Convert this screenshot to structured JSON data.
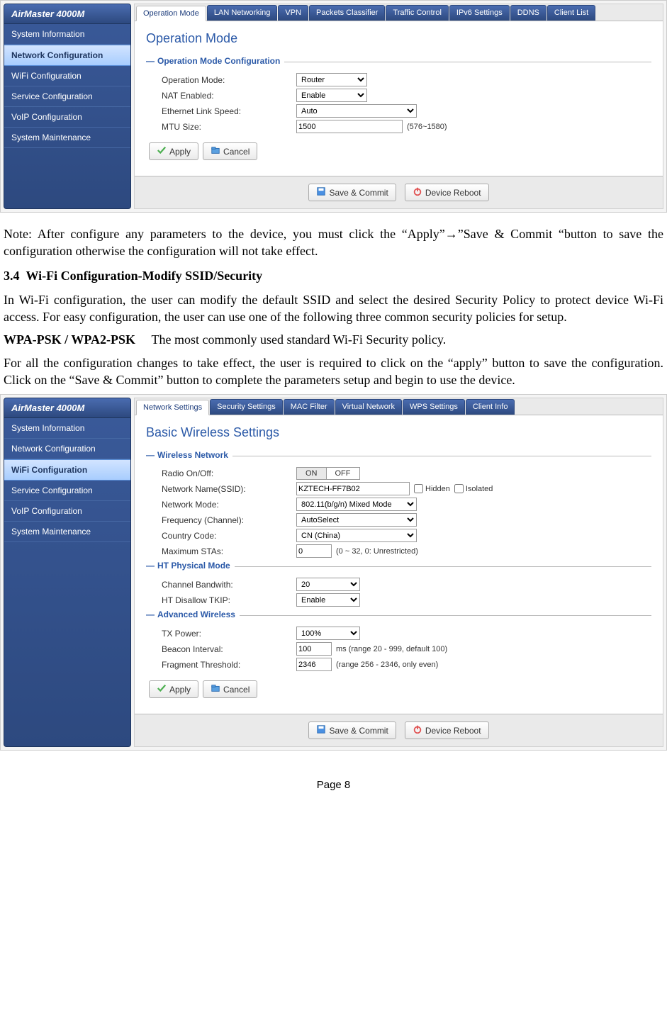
{
  "doc": {
    "note": "Note: After configure any parameters to the device, you must click the “Apply”→”Save & Commit “button to save the configuration otherwise the configuration will not take effect.",
    "section_number": "3.4",
    "section_title": "Wi-Fi Configuration-Modify SSID/Security",
    "para1": "In Wi-Fi configuration, the user can modify the default SSID and select the desired Security Policy to protect device Wi-Fi access. For easy configuration, the user can use one of the following three common security policies for setup.",
    "wpa_label": "WPA-PSK / WPA2-PSK",
    "wpa_desc": "The most commonly used standard Wi-Fi Security policy.",
    "para2": "For all the configuration changes to take effect, the user is required to click on the “apply” button to save the configuration. Click on the “Save & Commit” button to complete the parameters setup and begin to use the device.",
    "page_label": "Page 8"
  },
  "ui1": {
    "product": "AirMaster 4000M",
    "sidebar": [
      "System Information",
      "Network Configuration",
      "WiFi Configuration",
      "Service Configuration",
      "VoIP Configuration",
      "System Maintenance"
    ],
    "active_sidebar": 1,
    "tabs": [
      "Operation Mode",
      "LAN Networking",
      "VPN",
      "Packets Classifier",
      "Traffic Control",
      "IPv6 Settings",
      "DDNS",
      "Client List"
    ],
    "active_tab": 0,
    "title": "Operation Mode",
    "section": "Operation Mode Configuration",
    "rows": {
      "op_mode": {
        "label": "Operation Mode:",
        "value": "Router"
      },
      "nat": {
        "label": "NAT Enabled:",
        "value": "Enable"
      },
      "eth": {
        "label": "Ethernet Link Speed:",
        "value": "Auto"
      },
      "mtu": {
        "label": "MTU Size:",
        "value": "1500",
        "after": "(576~1580)"
      }
    },
    "buttons": {
      "apply": "Apply",
      "cancel": "Cancel",
      "save": "Save & Commit",
      "reboot": "Device Reboot"
    }
  },
  "ui2": {
    "product": "AirMaster 4000M",
    "sidebar": [
      "System Information",
      "Network Configuration",
      "WiFi Configuration",
      "Service Configuration",
      "VoIP Configuration",
      "System Maintenance"
    ],
    "active_sidebar": 2,
    "tabs": [
      "Network Settings",
      "Security Settings",
      "MAC Filter",
      "Virtual Network",
      "WPS Settings",
      "Client Info"
    ],
    "active_tab": 0,
    "title": "Basic Wireless Settings",
    "section1": "Wireless Network",
    "rows1": {
      "radio": {
        "label": "Radio On/Off:",
        "on": "ON",
        "off": "OFF"
      },
      "ssid": {
        "label": "Network Name(SSID):",
        "value": "KZTECH-FF7B02",
        "hidden": "Hidden",
        "isolated": "Isolated"
      },
      "mode": {
        "label": "Network Mode:",
        "value": "802.11(b/g/n) Mixed Mode"
      },
      "freq": {
        "label": "Frequency (Channel):",
        "value": "AutoSelect"
      },
      "country": {
        "label": "Country Code:",
        "value": "CN (China)"
      },
      "maxsta": {
        "label": "Maximum STAs:",
        "value": "0",
        "after": "(0 ~ 32, 0: Unrestricted)"
      }
    },
    "section2": "HT Physical Mode",
    "rows2": {
      "bw": {
        "label": "Channel Bandwith:",
        "value": "20"
      },
      "tkip": {
        "label": "HT Disallow TKIP:",
        "value": "Enable"
      }
    },
    "section3": "Advanced Wireless",
    "rows3": {
      "tx": {
        "label": "TX Power:",
        "value": "100%"
      },
      "beacon": {
        "label": "Beacon Interval:",
        "value": "100",
        "after": "ms (range 20 - 999, default 100)"
      },
      "frag": {
        "label": "Fragment Threshold:",
        "value": "2346",
        "after": "(range 256 - 2346, only even)"
      }
    },
    "buttons": {
      "apply": "Apply",
      "cancel": "Cancel",
      "save": "Save & Commit",
      "reboot": "Device Reboot"
    }
  }
}
